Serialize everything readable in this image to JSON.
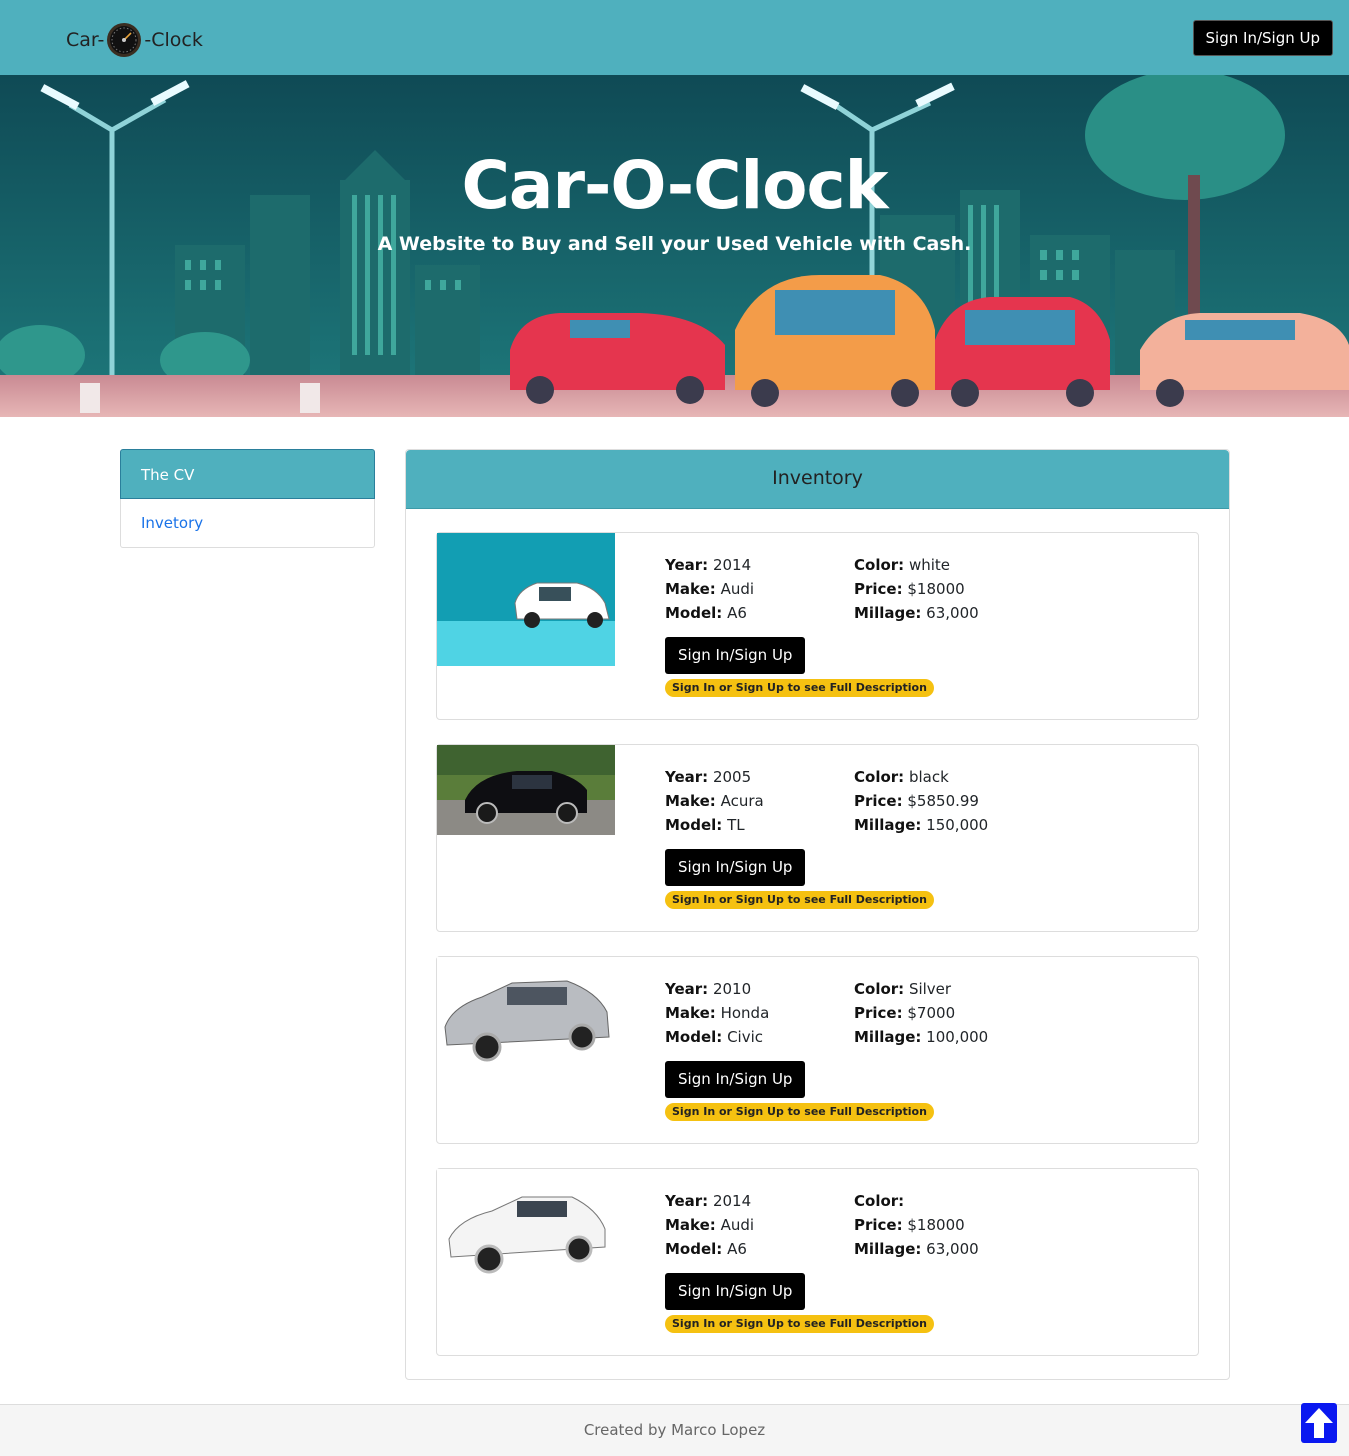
{
  "navbar": {
    "brand_left": "Car-",
    "brand_right": "-Clock",
    "signin_label": "Sign In/Sign Up",
    "bg_color": "#4fb0be"
  },
  "hero": {
    "title": "Car-O-Clock",
    "subtitle": "A Website to Buy and Sell your Used Vehicle with Cash."
  },
  "sidebar": {
    "items": [
      {
        "label": "The CV",
        "active": true
      },
      {
        "label": "Invetory",
        "active": false
      }
    ]
  },
  "inventory": {
    "title": "Inventory",
    "button_label": "Sign In/Sign Up",
    "badge_text": "Sign In or Sign Up to see Full Description",
    "labels": {
      "year": "Year:",
      "make": "Make:",
      "model": "Model:",
      "color": "Color:",
      "price": "Price:",
      "millage": "Millage:"
    },
    "cars": [
      {
        "year": "2014",
        "make": "Audi",
        "model": "A6",
        "color": "white",
        "price": "$18000",
        "millage": "63,000"
      },
      {
        "year": "2005",
        "make": "Acura",
        "model": "TL",
        "color": "black",
        "price": "$5850.99",
        "millage": "150,000"
      },
      {
        "year": "2010",
        "make": "Honda",
        "model": "Civic",
        "color": "Silver",
        "price": "$7000",
        "millage": "100,000"
      },
      {
        "year": "2014",
        "make": "Audi",
        "model": "A6",
        "color": "",
        "price": "$18000",
        "millage": "63,000"
      }
    ]
  },
  "footer": {
    "text": "Created by Marco Lopez",
    "scroll_top_icon": "arrow-up-icon"
  }
}
